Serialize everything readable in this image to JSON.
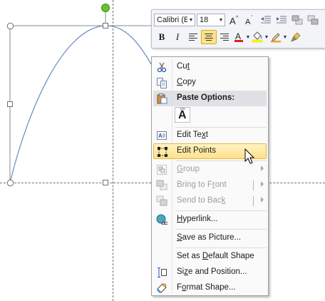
{
  "minibar": {
    "font_name": "Calibri (E",
    "font_size": "18"
  },
  "menu": {
    "cut": {
      "pre": "Cu",
      "acc": "t",
      "post": ""
    },
    "copy": {
      "pre": "",
      "acc": "C",
      "post": "opy"
    },
    "paste_options": "Paste Options:",
    "paste_glyph": "A",
    "edit_text": {
      "pre": "Edit Te",
      "acc": "x",
      "post": "t"
    },
    "edit_points": {
      "pre": "Edit Points",
      "acc": "",
      "post": ""
    },
    "group": {
      "pre": "",
      "acc": "G",
      "post": "roup"
    },
    "bring_to_front": {
      "pre": "Bring to F",
      "acc": "r",
      "post": "ont"
    },
    "send_to_back": {
      "pre": "Send to Bac",
      "acc": "k",
      "post": ""
    },
    "hyperlink": {
      "pre": "",
      "acc": "H",
      "post": "yperlink..."
    },
    "save_as_picture": {
      "pre": "",
      "acc": "S",
      "post": "ave as Picture..."
    },
    "set_default": {
      "pre": "Set as ",
      "acc": "D",
      "post": "efault Shape"
    },
    "size_position": {
      "pre": "Si",
      "acc": "z",
      "post": "e and Position..."
    },
    "format_shape": {
      "pre": "F",
      "acc": "o",
      "post": "rmat Shape..."
    }
  },
  "colors": {
    "highlight": "#ffe08b",
    "font_color": "#e02020",
    "fill_color": "#ffff00",
    "outline_color": "#f0a030",
    "rotate_handle": "#6ac237"
  }
}
